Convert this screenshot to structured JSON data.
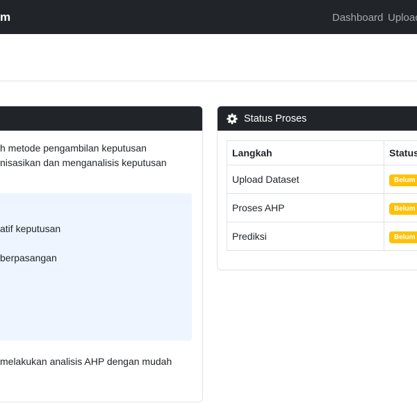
{
  "navbar": {
    "brand": "m",
    "links": [
      "Dashboard",
      "Uploac"
    ]
  },
  "left_card": {
    "lead_lines": [
      "h metode pengambilan keputusan",
      "nisasikan dan menganalisis keputusan"
    ],
    "info_lines": [
      "atif keputusan",
      "berpasangan"
    ],
    "bottom_line": "melakukan analisis AHP dengan mudah"
  },
  "status_card": {
    "title": "Status Proses",
    "icon": "gear-icon",
    "columns": [
      "Langkah",
      "Status"
    ],
    "rows": [
      {
        "step": "Upload Dataset",
        "status": "Belum"
      },
      {
        "step": "Proses AHP",
        "status": "Belum"
      },
      {
        "step": "Prediksi",
        "status": "Belum"
      }
    ]
  },
  "colors": {
    "navbar": "#212529",
    "badge_warning": "#ffc107",
    "info_box": "#eef5fe"
  }
}
